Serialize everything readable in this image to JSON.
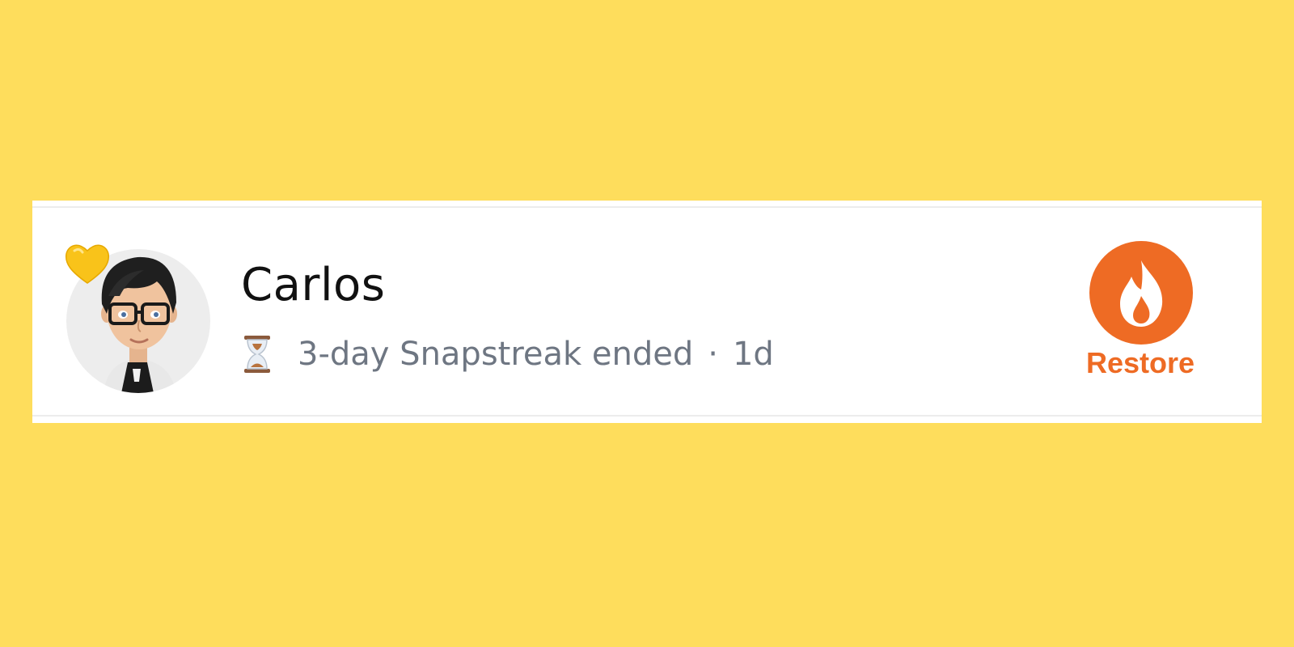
{
  "background_color": "#FEDD5C",
  "friend_row": {
    "name": "Carlos",
    "avatar_icon": "bitmoji-avatar-icon",
    "badge_icon": "yellow-heart-icon",
    "status_icon": "hourglass-icon",
    "status_text": "3-day Snapstreak ended",
    "separator": "·",
    "time_ago": "1d"
  },
  "restore_button": {
    "icon": "fire-icon",
    "label": "Restore",
    "color": "#EE6B24"
  }
}
